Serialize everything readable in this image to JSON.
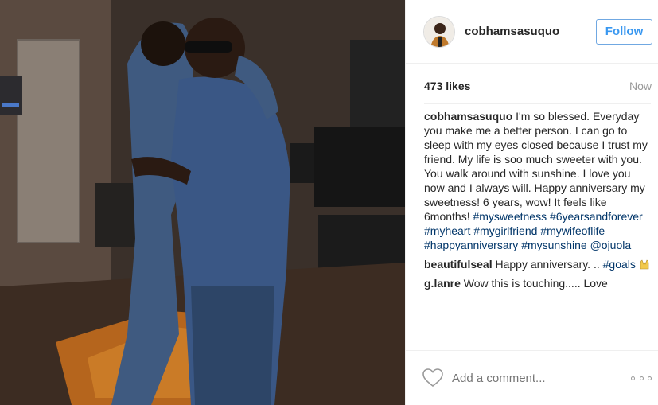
{
  "post": {
    "username": "cobhamsasuquo",
    "follow_label": "Follow",
    "likes": "473 likes",
    "time": "Now",
    "caption": {
      "user": "cobhamsasuquo",
      "text": " I'm so blessed. Everyday you make me a better person. I can go to sleep with my eyes closed because I trust my friend. My life is soo much sweeter with you. You walk around with sunshine. I love you now and I always will. Happy anniversary my sweetness! 6 years, wow! It feels like 6months! ",
      "tags": [
        "#mysweetness",
        "#6yearsandforever",
        "#myheart",
        "#mygirlfriend",
        "#mywifeoflife",
        "#happyanniversary",
        "#mysunshine"
      ],
      "mention": "@ojuola"
    },
    "comments": [
      {
        "user": "beautifulseal",
        "text": " Happy anniversary. .. ",
        "tag": "#goals",
        "emoji": "raised-hands"
      },
      {
        "user": "g.lanre",
        "text": " Wow this is touching..... Love"
      }
    ],
    "add_comment_placeholder": "Add a comment...",
    "icons": {
      "like": "heart-outline-icon",
      "more": "more-options-icon"
    },
    "colors": {
      "follow": "#3897f0",
      "hashtag": "#003569",
      "muted": "#999999"
    }
  }
}
